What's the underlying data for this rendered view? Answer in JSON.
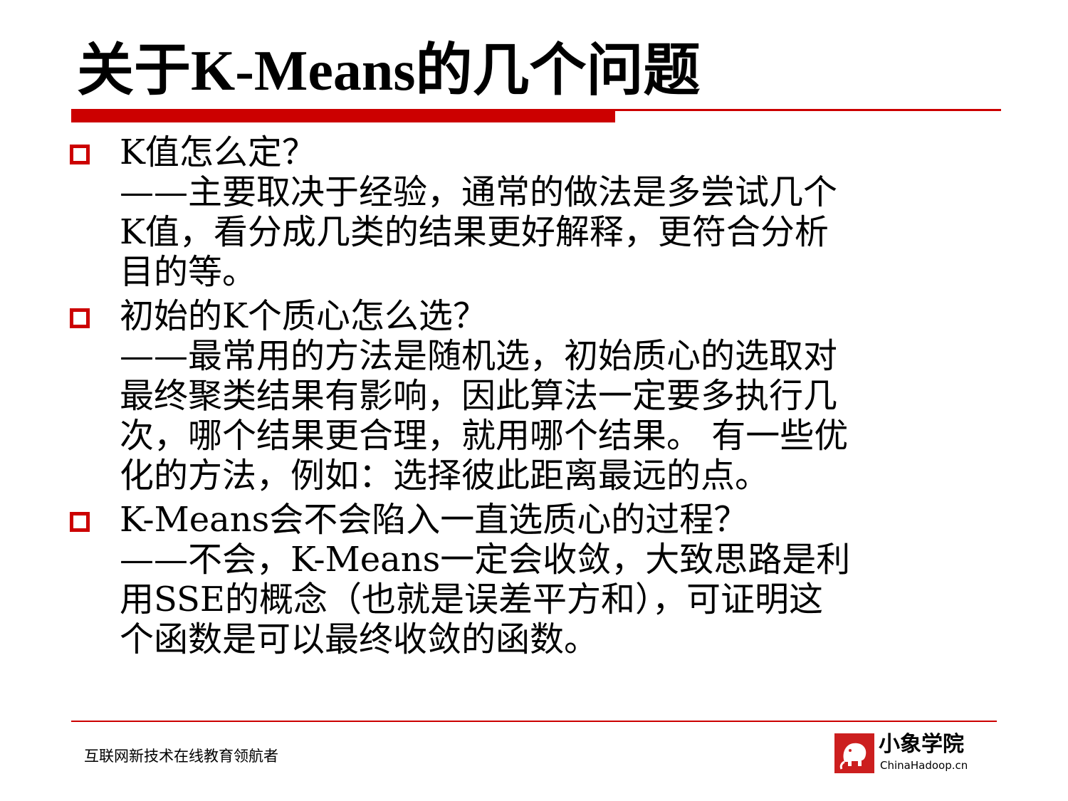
{
  "slide": {
    "title": "关于K-Means的几个问题"
  },
  "bullets": [
    {
      "text": "K值怎么定？\n——主要取决于经验，通常的做法是多尝试几个\nK值，看分成几类的结果更好解释，更符合分析\n目的等。"
    },
    {
      "text": "初始的K个质心怎么选？\n——最常用的方法是随机选，初始质心的选取对\n最终聚类结果有影响，因此算法一定要多执行几\n次，哪个结果更合理，就用哪个结果。 有一些优\n化的方法，例如：选择彼此距离最远的点。"
    },
    {
      "text": "K-Means会不会陷入一直选质心的过程？\n——不会，K-Means一定会收敛，大致思路是利\n用SSE的概念（也就是误差平方和），可证明这\n个函数是可以最终收敛的函数。"
    }
  ],
  "footer": {
    "slogan": "互联网新技术在线教育领航者",
    "logo_name": "小象学院",
    "logo_url": "ChinaHadoop.cn"
  },
  "colors": {
    "accent": "#cc0000",
    "logo": "#cc1f1f"
  },
  "icons": {
    "bullet": "hollow-square-bullet-icon",
    "logo": "elephant-logo-icon"
  }
}
